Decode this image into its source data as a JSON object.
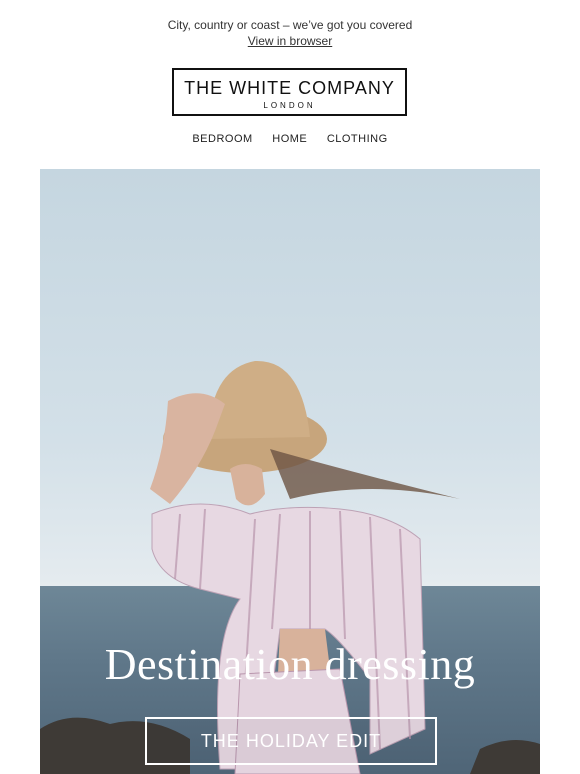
{
  "preheader": {
    "tagline": "City, country or coast – we’ve got you covered",
    "view_in_browser": "View in browser"
  },
  "logo": {
    "name": "THE WHITE COMPANY",
    "sub": "LONDON"
  },
  "nav": {
    "items": [
      "BEDROOM",
      "HOME",
      "CLOTHING"
    ]
  },
  "hero": {
    "headline": "Destination dressing",
    "cta": "THE HOLIDAY EDIT"
  }
}
